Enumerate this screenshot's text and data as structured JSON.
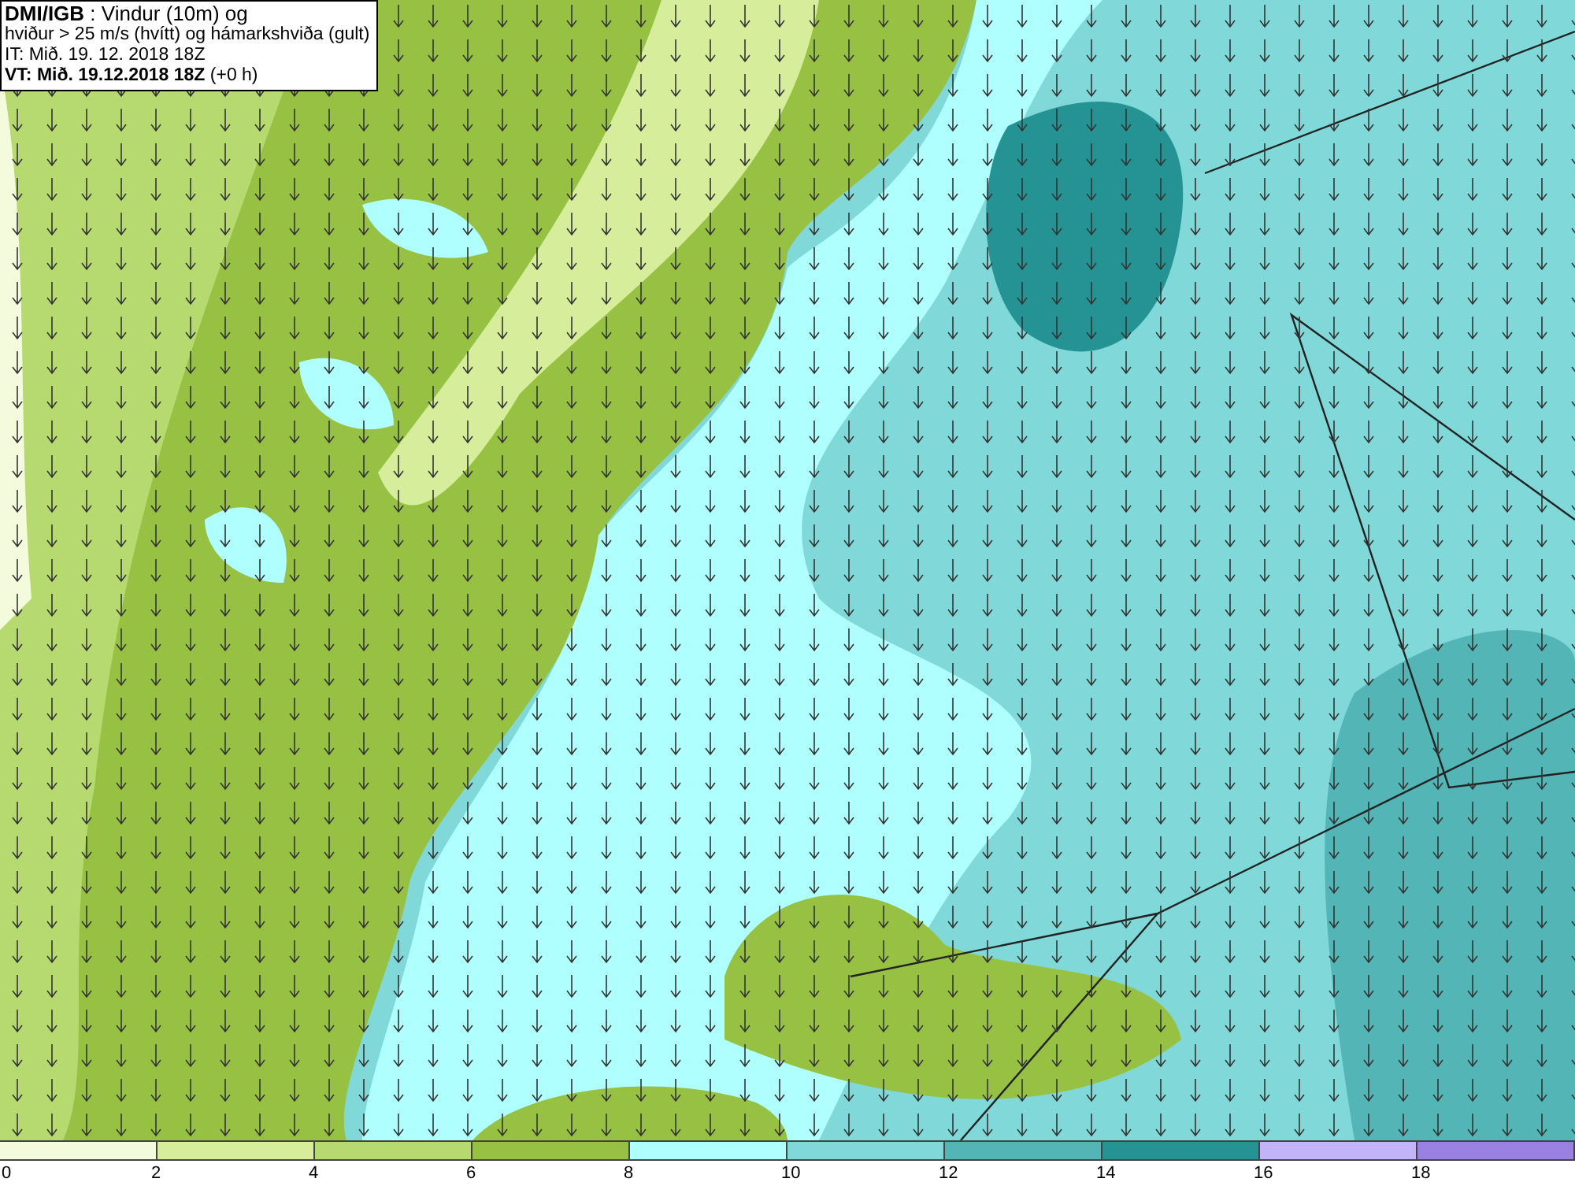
{
  "header": {
    "lines": [
      "**DMI/IGB** : Vindur (10m) og",
      "hviður > 25 m/s (hvítt) og hámarkshviða (gult)",
      "IT: Mið. 19. 12. 2018 18Z",
      "**VT: Mið. 19.12.2018 18Z** (+0 h)"
    ]
  },
  "legend": {
    "segments": [
      {
        "label": "0",
        "color": "#f4fbdc"
      },
      {
        "label": "2",
        "color": "#d6ee9c"
      },
      {
        "label": "4",
        "color": "#b6da70"
      },
      {
        "label": "6",
        "color": "#97c143"
      },
      {
        "label": "8",
        "color": "#aefffd"
      },
      {
        "label": "10",
        "color": "#80d8d8"
      },
      {
        "label": "12",
        "color": "#53b5b5"
      },
      {
        "label": "14",
        "color": "#259393"
      },
      {
        "label": "16",
        "color": "#c3b3f8"
      },
      {
        "label": "18",
        "color": "#9a80e0"
      }
    ]
  }
}
